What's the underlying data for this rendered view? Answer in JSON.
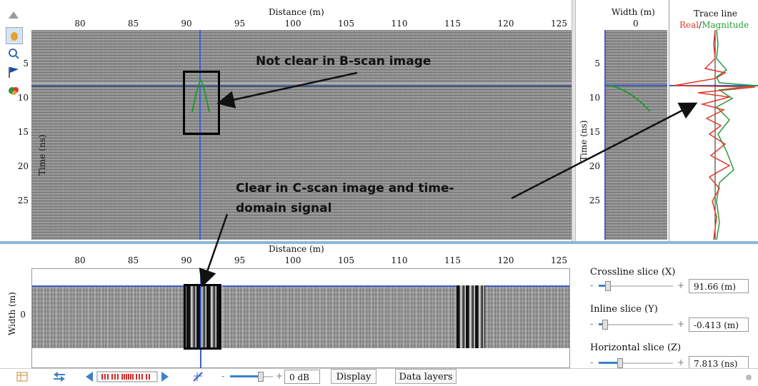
{
  "bscan": {
    "x_title": "Distance (m)",
    "x_ticks": [
      "80",
      "85",
      "90",
      "95",
      "100",
      "105",
      "110",
      "115",
      "120",
      "125"
    ],
    "y_title": "Time (ns)",
    "y_ticks": [
      "5",
      "10",
      "15",
      "20",
      "25"
    ]
  },
  "side": {
    "width_title": "Width (m)",
    "width_tick": "0",
    "y_title": "Time (ns)",
    "y_ticks": [
      "5",
      "10",
      "15",
      "20",
      "25"
    ],
    "trace_title": "Trace line",
    "trace_real": "Real",
    "trace_sep": "/",
    "trace_mag": "Magnitude",
    "real_color": "#e23a2a",
    "mag_color": "#2a9a3a"
  },
  "cscan": {
    "x_title": "Distance (m)",
    "x_ticks": [
      "80",
      "85",
      "90",
      "95",
      "100",
      "105",
      "110",
      "115",
      "120",
      "125"
    ],
    "y_title": "Width (m)",
    "y_tick": "0"
  },
  "annotations": {
    "b_scan_note": "Not clear in B-scan image",
    "c_scan_note_1": "Clear in C-scan image and time-",
    "c_scan_note_2": "domain signal"
  },
  "controls": {
    "crossline_label": "Crossline slice (X)",
    "crossline_value": "91.66 (m)",
    "inline_label": "Inline slice (Y)",
    "inline_value": "-0.413 (m)",
    "horizontal_label": "Horizontal slice (Z)",
    "horizontal_value": "7.813 (ns)",
    "minus": "-",
    "plus": "+",
    "crossline_level": 0.12,
    "inline_level": 0.08,
    "horizontal_level": 0.28
  },
  "toolbar": {
    "gain_value": "0 dB",
    "gain_level": 0.7,
    "display_label": "Display",
    "data_layers_label": "Data layers",
    "minus": "-",
    "plus": "+"
  },
  "colors": {
    "accent": "#3a82c8",
    "divider": "#8ab8d8",
    "crosshair": "#3a5fd0"
  }
}
